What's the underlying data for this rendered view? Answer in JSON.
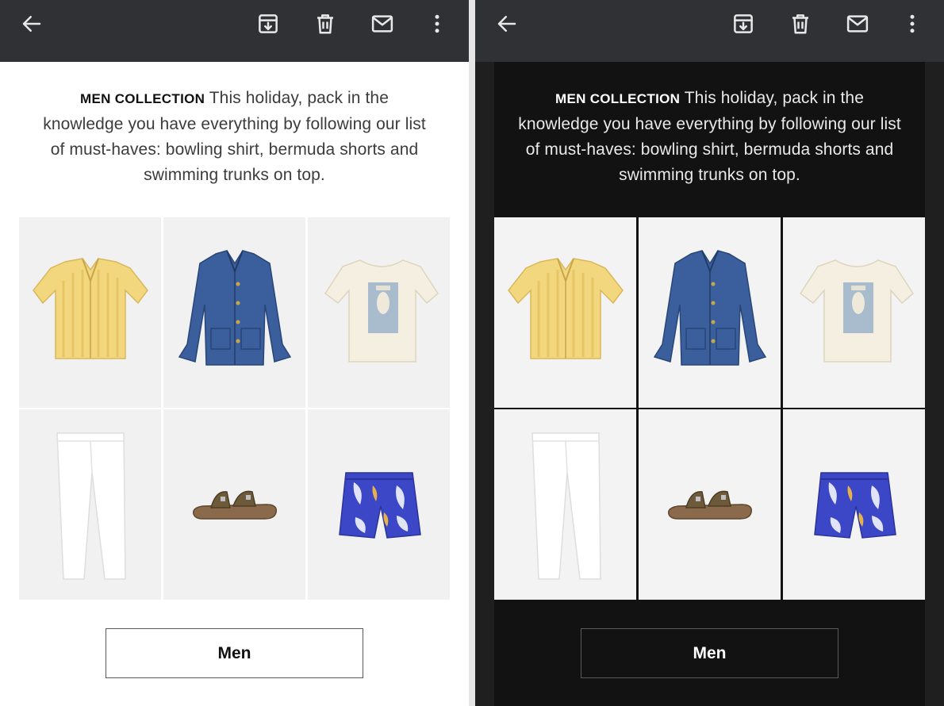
{
  "toolbar": {
    "back_icon": "arrow-left-icon",
    "archive_icon": "archive-icon",
    "delete_icon": "trash-icon",
    "mail_icon": "envelope-icon",
    "more_icon": "more-vertical-icon"
  },
  "email": {
    "title": "MEN COLLECTION",
    "body": " This holiday, pack in the knowledge you have everything by following our list of must-haves: bowling shirt, bermuda shorts and swimming trunks on top.",
    "products": [
      {
        "name": "yellow striped bowling shirt",
        "icon": "yellow-shirt-icon"
      },
      {
        "name": "denim overshirt jacket",
        "icon": "denim-jacket-icon"
      },
      {
        "name": "cream printed t-shirt",
        "icon": "printed-tshirt-icon"
      },
      {
        "name": "white linen trousers",
        "icon": "white-trousers-icon"
      },
      {
        "name": "brown buckle sandal",
        "icon": "sandal-icon"
      },
      {
        "name": "blue leaf print swim trunks",
        "icon": "swim-trunks-icon"
      }
    ],
    "cta_label": "Men"
  },
  "colors": {
    "appbar": "#303134",
    "light_background": "#ffffff",
    "dark_background": "#121212",
    "tile_background": "#f1f1f1"
  }
}
